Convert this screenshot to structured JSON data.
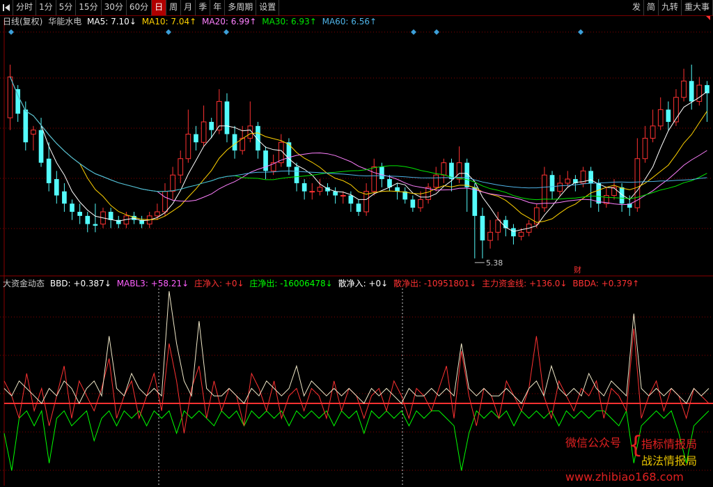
{
  "toolbar": {
    "left": [
      "分时",
      "1分",
      "5分",
      "15分",
      "30分",
      "60分",
      "日",
      "周",
      "月",
      "季",
      "年",
      "多周期",
      "设置"
    ],
    "active": "日",
    "right": [
      "发",
      "简",
      "九转",
      "重大事"
    ]
  },
  "colors": {
    "up": "#ff3232",
    "down": "#54fcfc",
    "ma5": "#ffffff",
    "ma10": "#ffd200",
    "ma20": "#ff80ff",
    "ma30": "#00e600",
    "ma60": "#4fb4e8",
    "bbd": "#ffffff",
    "mabl3": "#ff60ff",
    "zhuang_in": "#ff3232",
    "zhuang_out": "#00ff00",
    "san_in": "#ffffff",
    "san_out": "#ff3232",
    "zhuli": "#ff3232",
    "bbda": "#ff3232",
    "grid": "#8a0000",
    "zero": "#ff3232",
    "diamond": "#3c9fd8"
  },
  "ma_legend": {
    "title": "日线(复权)",
    "stock": "华能水电",
    "ma5": "MA5: 7.10↓",
    "ma10": "MA10: 7.04↑",
    "ma20": "MA20: 6.99↑",
    "ma30": "MA30: 6.93↑",
    "ma60": "MA60: 6.56↑"
  },
  "indicator": {
    "name": "大资金动态",
    "bbd": "BBD: +0.387↓",
    "mabl3": "MABL3: +58.21↓",
    "zhuang_in": "庄净入: +0↓",
    "zhuang_out": "庄净出: -16006478↓",
    "san_in": "散净入: +0↓",
    "san_out": "散净出: -10951801↓",
    "zhuli": "主力资金线: +136.0↓",
    "bbda": "BBDA: +0.379↑"
  },
  "annotations": {
    "low_price": "5.38",
    "finance_mark": "财"
  },
  "watermark": {
    "wechat": "微信公众号",
    "brace": "{",
    "name1": "指标情报局",
    "name2": "战法情报局",
    "url": "www.zhibiao168.com"
  },
  "chart_data": {
    "type": "candlestick",
    "price_range": [
      5.2,
      8.2
    ],
    "low_price": 5.38,
    "ma_smoothing": [
      5,
      10,
      20,
      30,
      60
    ],
    "candles": [
      [
        7.1,
        7.6,
        6.95,
        7.75
      ],
      [
        7.45,
        7.15,
        7.05,
        7.5
      ],
      [
        7.2,
        6.8,
        6.7,
        7.3
      ],
      [
        6.9,
        6.95,
        6.7,
        7.0
      ],
      [
        6.95,
        6.55,
        6.5,
        7.1
      ],
      [
        6.6,
        6.3,
        6.2,
        6.8
      ],
      [
        6.35,
        6.15,
        6.05,
        6.45
      ],
      [
        6.2,
        6.05,
        5.95,
        6.3
      ],
      [
        6.05,
        5.95,
        5.85,
        6.1
      ],
      [
        5.95,
        5.9,
        5.8,
        6.05
      ],
      [
        5.9,
        5.8,
        5.7,
        5.95
      ],
      [
        5.8,
        5.78,
        5.7,
        6.05
      ],
      [
        5.8,
        5.95,
        5.75,
        6.0
      ],
      [
        5.95,
        5.85,
        5.75,
        6.0
      ],
      [
        5.85,
        5.8,
        5.75,
        5.9
      ],
      [
        5.8,
        5.9,
        5.75,
        5.95
      ],
      [
        5.9,
        5.85,
        5.8,
        5.95
      ],
      [
        5.85,
        5.8,
        5.75,
        5.9
      ],
      [
        5.8,
        5.9,
        5.75,
        5.95
      ],
      [
        5.9,
        5.95,
        5.85,
        6.05
      ],
      [
        5.95,
        6.2,
        5.9,
        6.3
      ],
      [
        6.2,
        6.4,
        6.1,
        6.5
      ],
      [
        6.4,
        6.6,
        6.3,
        6.7
      ],
      [
        6.6,
        6.9,
        6.55,
        7.2
      ],
      [
        6.9,
        6.8,
        6.7,
        7.0
      ],
      [
        6.8,
        7.05,
        6.75,
        7.25
      ],
      [
        7.05,
        6.95,
        6.85,
        7.1
      ],
      [
        6.95,
        7.3,
        6.9,
        7.45
      ],
      [
        7.3,
        6.9,
        6.8,
        7.4
      ],
      [
        6.9,
        6.7,
        6.6,
        7.0
      ],
      [
        6.7,
        6.85,
        6.65,
        7.0
      ],
      [
        6.85,
        7.0,
        6.8,
        7.3
      ],
      [
        7.0,
        6.7,
        6.6,
        7.05
      ],
      [
        6.7,
        6.45,
        6.35,
        6.75
      ],
      [
        6.45,
        6.55,
        6.4,
        6.65
      ],
      [
        6.55,
        6.8,
        6.5,
        6.9
      ],
      [
        6.8,
        6.5,
        6.4,
        6.85
      ],
      [
        6.5,
        6.3,
        6.2,
        6.55
      ],
      [
        6.3,
        6.2,
        6.1,
        6.35
      ],
      [
        6.2,
        6.2,
        6.1,
        6.3
      ],
      [
        6.2,
        6.25,
        6.15,
        6.35
      ],
      [
        6.25,
        6.2,
        6.15,
        6.3
      ],
      [
        6.2,
        6.15,
        6.05,
        6.25
      ],
      [
        6.15,
        6.15,
        6.05,
        6.2
      ],
      [
        6.15,
        6.05,
        5.95,
        6.2
      ],
      [
        6.05,
        5.95,
        5.9,
        6.1
      ],
      [
        5.95,
        6.2,
        5.9,
        6.3
      ],
      [
        6.2,
        6.5,
        6.15,
        6.6
      ],
      [
        6.5,
        6.35,
        6.25,
        6.55
      ],
      [
        6.35,
        6.25,
        6.2,
        6.4
      ],
      [
        6.25,
        6.2,
        6.1,
        6.3
      ],
      [
        6.2,
        6.1,
        6.05,
        6.25
      ],
      [
        6.1,
        6.0,
        5.95,
        6.15
      ],
      [
        6.0,
        6.1,
        5.95,
        6.2
      ],
      [
        6.1,
        6.25,
        6.05,
        6.3
      ],
      [
        6.25,
        6.4,
        6.2,
        6.5
      ],
      [
        6.4,
        6.55,
        6.3,
        6.6
      ],
      [
        6.55,
        6.35,
        6.2,
        6.6
      ],
      [
        6.35,
        6.55,
        6.3,
        6.75
      ],
      [
        6.55,
        6.25,
        5.95,
        6.6
      ],
      [
        6.25,
        5.9,
        5.38,
        6.3
      ],
      [
        5.9,
        5.6,
        5.38,
        6.0
      ],
      [
        5.6,
        5.7,
        5.5,
        5.85
      ],
      [
        5.7,
        5.85,
        5.6,
        5.95
      ],
      [
        5.85,
        5.75,
        5.65,
        5.9
      ],
      [
        5.75,
        5.65,
        5.55,
        5.8
      ],
      [
        5.65,
        5.7,
        5.6,
        5.75
      ],
      [
        5.7,
        5.8,
        5.65,
        5.85
      ],
      [
        5.8,
        6.0,
        5.75,
        6.05
      ],
      [
        6.0,
        6.4,
        5.95,
        6.5
      ],
      [
        6.4,
        6.2,
        6.1,
        6.45
      ],
      [
        6.2,
        6.3,
        6.15,
        6.4
      ],
      [
        6.3,
        6.35,
        6.25,
        6.45
      ],
      [
        6.35,
        6.3,
        6.2,
        6.4
      ],
      [
        6.3,
        6.45,
        6.25,
        6.5
      ],
      [
        6.45,
        6.3,
        6.0,
        6.5
      ],
      [
        6.3,
        6.05,
        5.95,
        6.35
      ],
      [
        6.05,
        6.15,
        6.0,
        6.25
      ],
      [
        6.15,
        6.25,
        6.1,
        6.35
      ],
      [
        6.25,
        6.05,
        5.95,
        6.3
      ],
      [
        6.05,
        6.0,
        5.9,
        6.15
      ],
      [
        6.0,
        6.6,
        5.95,
        6.85
      ],
      [
        6.6,
        6.85,
        6.55,
        7.0
      ],
      [
        6.85,
        7.0,
        6.8,
        7.2
      ],
      [
        7.0,
        7.2,
        6.95,
        7.35
      ],
      [
        7.2,
        7.05,
        6.95,
        7.3
      ],
      [
        7.05,
        7.35,
        7.0,
        7.45
      ],
      [
        7.35,
        7.55,
        7.3,
        7.7
      ],
      [
        7.55,
        7.3,
        7.2,
        7.75
      ],
      [
        7.3,
        7.5,
        7.25,
        7.6
      ],
      [
        7.5,
        7.4,
        7.05,
        7.55
      ]
    ],
    "indicator_range": [
      -1.1,
      1.5
    ],
    "bbd_series": [
      0.2,
      0.1,
      0.3,
      0.2,
      0.1,
      0.0,
      0.2,
      0.1,
      0.3,
      0.2,
      0.0,
      0.2,
      0.3,
      0.1,
      0.9,
      0.2,
      0.1,
      0.4,
      0.2,
      0.1,
      0.2,
      0.1,
      1.5,
      0.8,
      0.3,
      0.1,
      1.1,
      0.2,
      0.1,
      0.1,
      0.2,
      0.1,
      0.0,
      0.2,
      0.1,
      0.3,
      0.2,
      0.1,
      0.2,
      0.5,
      0.1,
      0.3,
      0.2,
      0.1,
      0.2,
      0.1,
      0.2,
      0.1,
      0.0,
      0.2,
      0.1,
      0.2,
      0.1,
      0.0,
      0.2,
      0.1,
      0.1,
      0.2,
      0.1,
      0.2,
      0.1,
      0.8,
      0.2,
      0.1,
      0.2,
      0.1,
      0.1,
      0.2,
      0.1,
      0.0,
      0.2,
      0.3,
      0.1,
      0.5,
      0.2,
      0.1,
      0.2,
      0.1,
      0.4,
      0.2,
      0.1,
      0.3,
      0.2,
      0.1,
      1.2,
      0.2,
      0.1,
      0.2,
      0.1,
      0.2,
      0.1,
      0.0,
      0.2,
      0.1,
      0.2
    ],
    "zhuang_series": [
      0.3,
      0.1,
      -0.2,
      0.4,
      -0.1,
      0.2,
      -0.3,
      0.1,
      0.5,
      -0.2,
      0.3,
      0.1,
      -0.1,
      0.2,
      0.6,
      -0.2,
      0.1,
      0.3,
      -0.2,
      0.1,
      0.4,
      -0.1,
      0.8,
      0.3,
      -0.4,
      0.2,
      0.5,
      -0.2,
      0.3,
      -0.1,
      0.2,
      0.1,
      -0.3,
      0.4,
      0.2,
      -0.1,
      0.3,
      -0.2,
      0.1,
      0.2,
      -0.1,
      0.2,
      0.1,
      -0.2,
      0.3,
      -0.1,
      0.2,
      0.1,
      -0.2,
      0.1,
      0.2,
      -0.1,
      0.3,
      0.1,
      -0.2,
      0.2,
      0.1,
      -0.1,
      0.2,
      0.5,
      -0.2,
      0.7,
      0.1,
      -0.3,
      0.2,
      0.1,
      -0.2,
      0.3,
      0.1,
      -0.1,
      0.2,
      0.9,
      0.1,
      -0.2,
      0.3,
      0.1,
      -0.1,
      0.2,
      0.1,
      0.3,
      -0.2,
      0.2,
      0.1,
      -0.1,
      1.0,
      -0.2,
      0.1,
      0.3,
      -0.1,
      0.2,
      0.1,
      -0.2,
      0.2,
      0.1,
      0.0
    ],
    "san_series": [
      -0.4,
      -0.9,
      -0.2,
      -0.1,
      -0.3,
      -0.1,
      -0.8,
      -0.2,
      -0.1,
      -0.3,
      -0.2,
      -0.1,
      -0.5,
      -0.2,
      -0.1,
      -0.3,
      -0.1,
      -0.2,
      -0.1,
      -0.3,
      -0.1,
      -0.2,
      -0.1,
      -0.4,
      -0.1,
      -0.2,
      -0.1,
      -0.2,
      -0.3,
      -0.1,
      -0.2,
      -0.1,
      -0.3,
      -0.1,
      -0.2,
      -0.1,
      -0.2,
      -0.1,
      -0.3,
      -0.1,
      -0.2,
      -0.1,
      -0.2,
      -0.1,
      -0.3,
      -0.1,
      -0.2,
      -0.1,
      -0.4,
      -0.1,
      -0.2,
      -0.1,
      -0.2,
      -0.1,
      -0.3,
      -0.1,
      -0.2,
      -0.1,
      -0.1,
      -0.2,
      -0.3,
      -0.9,
      -0.4,
      -0.1,
      -0.2,
      -0.1,
      -0.2,
      -0.1,
      -0.3,
      -0.1,
      -0.2,
      -0.1,
      -0.2,
      -0.1,
      -0.3,
      -0.1,
      -0.2,
      -0.1,
      -0.2,
      -0.1,
      -0.1,
      -0.2,
      -0.3,
      -0.1,
      -0.8,
      -0.3,
      -0.2,
      -0.1,
      -0.2,
      -0.1,
      -0.4,
      -0.8,
      -0.3,
      -0.2,
      -0.1
    ]
  }
}
